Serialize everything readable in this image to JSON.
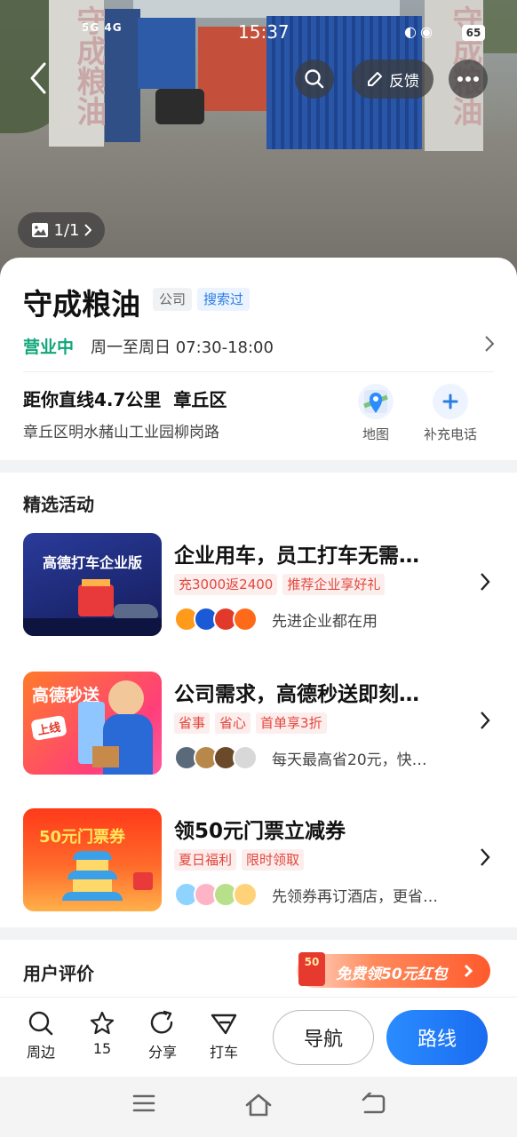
{
  "status_bar": {
    "network": "5G 4G",
    "time": "15:37",
    "battery": "65"
  },
  "hero": {
    "pillar_text": "守成粮油",
    "photo_counter": "1/1"
  },
  "header": {
    "feedback_label": "反馈"
  },
  "poi": {
    "name": "守成粮油",
    "category_tag": "公司",
    "searched_tag": "搜索过",
    "open_status": "营业中",
    "hours": "周一至周日 07:30-18:00",
    "distance": "距你直线4.7公里",
    "district": "章丘区",
    "address": "章丘区明水赭山工业园柳岗路",
    "actions": [
      {
        "label": "地图",
        "icon": "map-pin-icon"
      },
      {
        "label": "补充电话",
        "icon": "plus-icon"
      }
    ]
  },
  "activities": {
    "section_title": "精选活动",
    "items": [
      {
        "thumb_label": "高德打车企业版",
        "title": "企业用车，员工打车无需…",
        "tags": [
          "充3000返2400",
          "推荐企业享好礼"
        ],
        "subtitle": "先进企业都在用",
        "thumb_color": "#1c2a78"
      },
      {
        "thumb_label": "高德秒送",
        "thumb_badge": "上线",
        "title": "公司需求，高德秒送即刻…",
        "tags": [
          "省事",
          "省心",
          "首单享3折"
        ],
        "subtitle": "每天最高省20元，快…",
        "thumb_color": "#ff5a7a"
      },
      {
        "thumb_label": "50元门票券",
        "title": "领50元门票立减券",
        "tags": [
          "夏日福利",
          "限时领取"
        ],
        "subtitle": "先领券再订酒店，更省…",
        "thumb_color": "#ff4a2a"
      }
    ]
  },
  "reviews": {
    "title": "用户评价",
    "promo_badge": "50",
    "promo_text": "免费领50元红包"
  },
  "bottom_bar": {
    "tools": [
      {
        "label": "周边",
        "icon": "search-icon"
      },
      {
        "label": "15",
        "icon": "star-icon"
      },
      {
        "label": "分享",
        "icon": "share-icon"
      },
      {
        "label": "打车",
        "icon": "taxi-icon"
      }
    ],
    "navigate_label": "导航",
    "route_label": "路线"
  },
  "colors": {
    "open_green": "#12a67a",
    "primary_blue": "#1a6cf0",
    "tag_red": "#e2473c"
  }
}
